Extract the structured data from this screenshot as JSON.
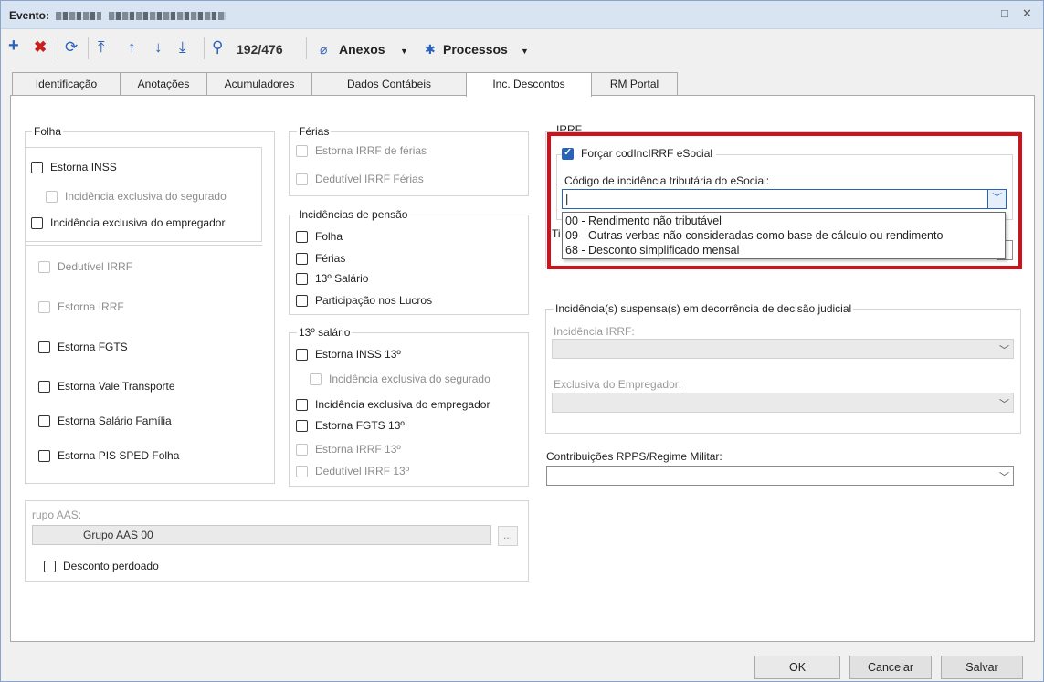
{
  "window": {
    "title_prefix": "Evento:",
    "restore_glyph": "□",
    "close_glyph": "✕"
  },
  "toolbar": {
    "record_position": "192/476",
    "attachments_label": "Anexos",
    "processes_label": "Processos"
  },
  "tabs": [
    {
      "label": "Identificação"
    },
    {
      "label": "Anotações"
    },
    {
      "label": "Acumuladores"
    },
    {
      "label": "Dados Contábeis"
    },
    {
      "label": "Inc. Descontos",
      "active": true
    },
    {
      "label": "RM Portal"
    }
  ],
  "folha": {
    "legend": "Folha",
    "items": [
      "Estorna INSS",
      "Incidência exclusiva do segurado",
      "Incidência exclusiva do empregador",
      "Dedutível IRRF",
      "Estorna IRRF",
      "Estorna FGTS",
      "Estorna Vale Transporte",
      "Estorna Salário Família",
      "Estorna PIS SPED Folha"
    ]
  },
  "ferias": {
    "legend": "Férias",
    "items": [
      "Estorna IRRF de férias",
      "Dedutível IRRF Férias"
    ]
  },
  "pensao": {
    "legend": "Incidências de pensão",
    "items": [
      "Folha",
      "Férias",
      "13º Salário",
      "Participação nos Lucros"
    ]
  },
  "decimo": {
    "legend": "13º salário",
    "items": [
      "Estorna INSS 13º",
      "Incidência exclusiva do segurado",
      "Incidência exclusiva do empregador",
      "Estorna FGTS 13º",
      "Estorna IRRF 13º",
      "Dedutível IRRF 13º"
    ]
  },
  "aas": {
    "label": "rupo AAS:",
    "value": "Grupo AAS 00",
    "browse": "...",
    "checkbox": "Desconto perdoado"
  },
  "irrf": {
    "legend": "IRRF",
    "force_checkbox": "Forçar codIncIRRF eSocial",
    "force_checked": true,
    "code_label": "Código de incidência tributária do eSocial:",
    "code_value": "|",
    "hidden_label_fragment": "Ti",
    "options": [
      "00 - Rendimento não tributável",
      "09 - Outras verbas não consideradas como base de cálculo ou rendimento",
      "68 - Desconto simplificado mensal"
    ]
  },
  "suspensa": {
    "legend": "Incidência(s) suspensa(s) em decorrência de decisão judicial",
    "irrf_label": "Incidência IRRF:",
    "empregador_label": "Exclusiva do Empregador:"
  },
  "rpps": {
    "label": "Contribuições RPPS/Regime Militar:"
  },
  "footer": {
    "ok": "OK",
    "cancel": "Cancelar",
    "save": "Salvar"
  },
  "colors": {
    "highlight_border": "#d0101a",
    "checkbox_checked": "#2a62b8",
    "add_icon": "#2a62b8",
    "delete_icon": "#c81e1e"
  }
}
